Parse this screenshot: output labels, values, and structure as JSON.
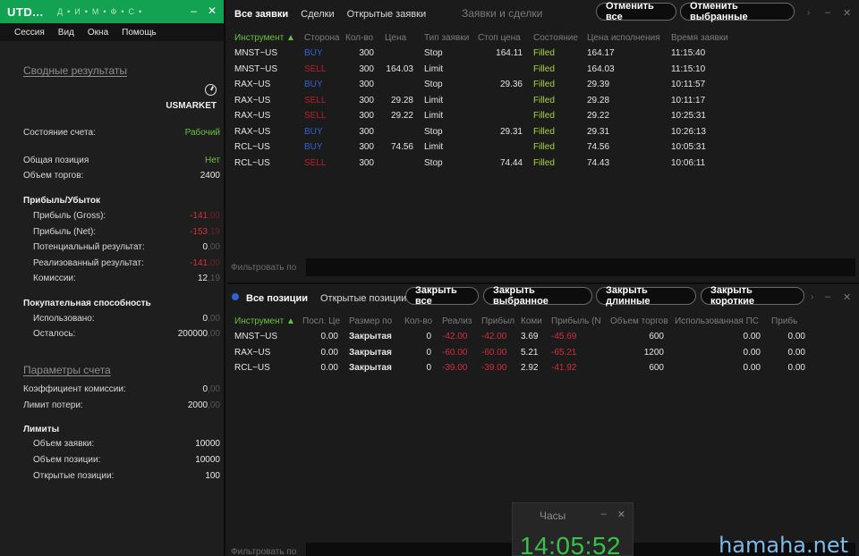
{
  "left": {
    "title": "UTD...",
    "title_letters": [
      "Д",
      "И",
      "М",
      "Ф",
      "С"
    ],
    "menu": [
      "Сессия",
      "Вид",
      "Окна",
      "Помощь"
    ],
    "summary_link": "Сводные результаты",
    "market": "USMARKET",
    "account_state_label": "Состояние счета:",
    "account_state_value": "Рабочий",
    "total_position_label": "Общая позиция",
    "total_position_value": "Нет",
    "volume_label": "Объем торгов:",
    "volume_value": "2400",
    "pnl_header": "Прибыль/Убыток",
    "gross_label": "Прибыль (Gross):",
    "gross_value": "-141",
    "gross_frac": ",00",
    "net_label": "Прибыль (Net):",
    "net_value": "-153",
    "net_frac": ",19",
    "potential_label": "Потенциальный результат:",
    "potential_value": "0",
    "potential_frac": ",00",
    "realized_label": "Реализованный результат:",
    "realized_value": "-141",
    "realized_frac": ",00",
    "commission_label": "Комиссии:",
    "commission_value": "12",
    "commission_frac": ",19",
    "buying_header": "Покупательная способность",
    "used_label": "Использовано:",
    "used_value": "0",
    "used_frac": ",00",
    "left_label": "Осталось:",
    "left_value": "200000",
    "left_frac": ",00",
    "params_link": "Параметры счета",
    "coef_label": "Коэффициент комиссии:",
    "coef_value": "0",
    "coef_frac": ",00",
    "loss_limit_label": "Лимит потери:",
    "loss_limit_value": "2000",
    "loss_limit_frac": ",00",
    "limits_header": "Лимиты",
    "order_vol_label": "Объем заявки:",
    "order_vol_value": "10000",
    "pos_vol_label": "Объем позиции:",
    "pos_vol_value": "10000",
    "open_pos_label": "Открытые позиции:",
    "open_pos_value": "100"
  },
  "orders": {
    "tabs": [
      "Все заявки",
      "Сделки",
      "Открытые заявки"
    ],
    "title": "Заявки и сделки",
    "cancel_all": "Отменить все",
    "cancel_selected": "Отменить выбранные",
    "columns": [
      "Инструмент",
      "Сторона",
      "Кол-во",
      "Цена",
      "Тип заявки",
      "Стоп цена",
      "Состояние",
      "Цена исполнения",
      "Время заявки"
    ],
    "rows": [
      [
        "MNST~US",
        "BUY",
        "300",
        "",
        "Stop",
        "164.11",
        "Filled",
        "164.17",
        "11:15:40"
      ],
      [
        "MNST~US",
        "SELL",
        "300",
        "164.03",
        "Limit",
        "",
        "Filled",
        "164.03",
        "11:15:10"
      ],
      [
        "RAX~US",
        "BUY",
        "300",
        "",
        "Stop",
        "29.36",
        "Filled",
        "29.39",
        "10:11:57"
      ],
      [
        "RAX~US",
        "SELL",
        "300",
        "29.28",
        "Limit",
        "",
        "Filled",
        "29.28",
        "10:11:17"
      ],
      [
        "RAX~US",
        "SELL",
        "300",
        "29.22",
        "Limit",
        "",
        "Filled",
        "29.22",
        "10:25:31"
      ],
      [
        "RAX~US",
        "BUY",
        "300",
        "",
        "Stop",
        "29.31",
        "Filled",
        "29.31",
        "10:26:13"
      ],
      [
        "RCL~US",
        "BUY",
        "300",
        "74.56",
        "Limit",
        "",
        "Filled",
        "74.56",
        "10:05:31"
      ],
      [
        "RCL~US",
        "SELL",
        "300",
        "",
        "Stop",
        "74.44",
        "Filled",
        "74.43",
        "10:06:11"
      ]
    ],
    "filter_label": "Фильтровать по"
  },
  "positions": {
    "tabs": [
      "Все позиции",
      "Открытые позиции"
    ],
    "close_all": "Закрыть все",
    "close_selected": "Закрыть выбранное",
    "close_long": "Закрыть длинные",
    "close_short": "Закрыть короткие",
    "columns": [
      "Инструмент",
      "Посл. Це",
      "Размер по",
      "Кол-во",
      "Реализ",
      "Прибыл",
      "Коми",
      "Прибыль (N",
      "Объем торгов",
      "Использованная ПС",
      "Прибь"
    ],
    "rows": [
      [
        "MNST~US",
        "0.00",
        "Закрытая",
        "0",
        "-42.00",
        "-42.00",
        "3.69",
        "-45.69",
        "600",
        "0.00",
        "0.00"
      ],
      [
        "RAX~US",
        "0.00",
        "Закрытая",
        "0",
        "-60.00",
        "-60.00",
        "5.21",
        "-65.21",
        "1200",
        "0.00",
        "0.00"
      ],
      [
        "RCL~US",
        "0.00",
        "Закрытая",
        "0",
        "-39.00",
        "-39.00",
        "2.92",
        "-41.92",
        "600",
        "0.00",
        "0.00"
      ]
    ],
    "filter_label": "Фильтровать по"
  },
  "clock": {
    "title": "Часы",
    "time": "14:05:52"
  },
  "watermark": "hamaha.net",
  "colors": {
    "title_green": "#13a252",
    "buy_blue": "#2f63d0",
    "sell_red": "#b8202c",
    "filled_green": "#a9d43c",
    "clock_green": "#39c24a"
  }
}
